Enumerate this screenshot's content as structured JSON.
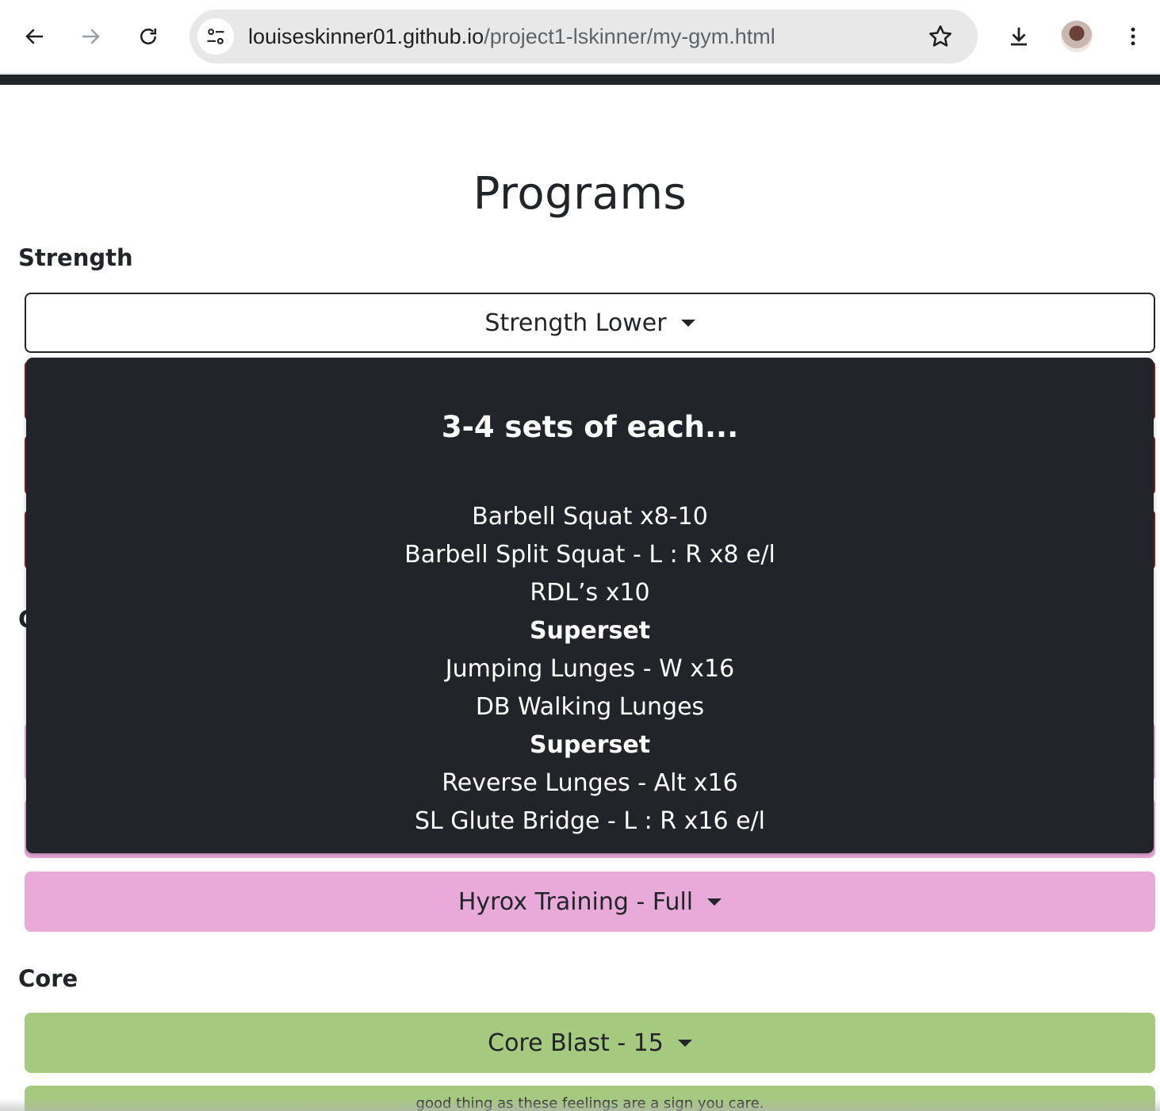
{
  "browser": {
    "url_host": "louiseskinner01.github.io",
    "url_path": "/project1-lskinner/my-gym.html"
  },
  "page": {
    "title": "Programs",
    "sections": {
      "strength": "Strength",
      "cardio_partial": "C",
      "core": "Core"
    },
    "strength_dropdown": {
      "label": "Strength Lower",
      "menu_heading": "3-4 sets of each...",
      "items": [
        {
          "text": "Barbell Squat x8-10",
          "bold": false
        },
        {
          "text": "Barbell Split Squat - L : R x8 e/l",
          "bold": false
        },
        {
          "text": "RDL’s x10",
          "bold": false
        },
        {
          "text": "Superset",
          "bold": true
        },
        {
          "text": "Jumping Lunges - W x16",
          "bold": false
        },
        {
          "text": "DB Walking Lunges",
          "bold": false
        },
        {
          "text": "Superset",
          "bold": true
        },
        {
          "text": "Reverse Lunges - Alt x16",
          "bold": false
        },
        {
          "text": "SL Glute Bridge - L : R x16 e/l",
          "bold": false
        }
      ]
    },
    "hyrox_dropdown": {
      "label": "Hyrox Training - Full"
    },
    "core_dropdown": {
      "label": "Core Blast - 15"
    },
    "bottom_partial_text": "good thing as these feelings are a sign you care."
  },
  "colors": {
    "dark": "#212529",
    "pink": "#e8abd9",
    "green": "#a5c97e",
    "red_border": "#8b1a24"
  }
}
